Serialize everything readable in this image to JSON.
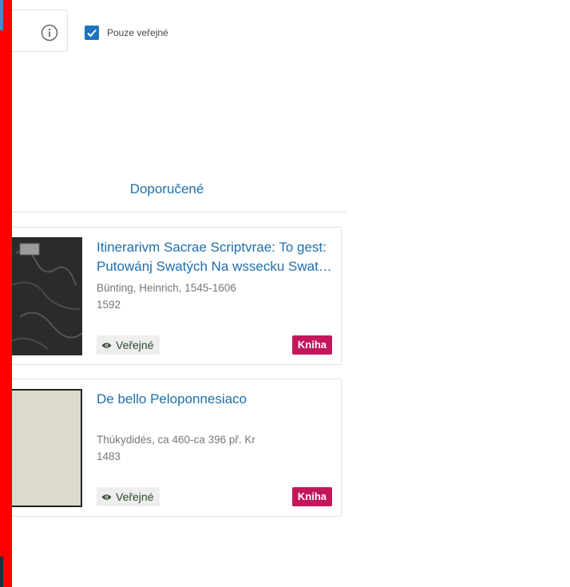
{
  "filters": {
    "public_only_label": "Pouze veřejné",
    "public_only_checked": true
  },
  "tabs": {
    "recommended": "Doporučené"
  },
  "results": [
    {
      "title_line1": "Itinerarivm Sacrae Scriptvrae: To gest:",
      "title_line2": "Putowánj Swatých Na wssecku Swat…",
      "author": "Bünting, Heinrich, 1545-1606",
      "year": "1592",
      "access": "Veřejné",
      "type": "Kniha",
      "thumbnail_icon": "book-cover-dark-thumbnail"
    },
    {
      "title_line1": "De bello Peloponnesiaco",
      "title_line2": "",
      "author": "Thúkydidés, ca 460-ca 396 př. Kr",
      "year": "1483",
      "access": "Veřejné",
      "type": "Kniha",
      "thumbnail_icon": "book-cover-light-thumbnail"
    }
  ],
  "colors": {
    "accent": "#1e6fad",
    "checkbox": "#1e73be",
    "type_badge": "#c2185b",
    "overlay_red": "#ff0000"
  }
}
